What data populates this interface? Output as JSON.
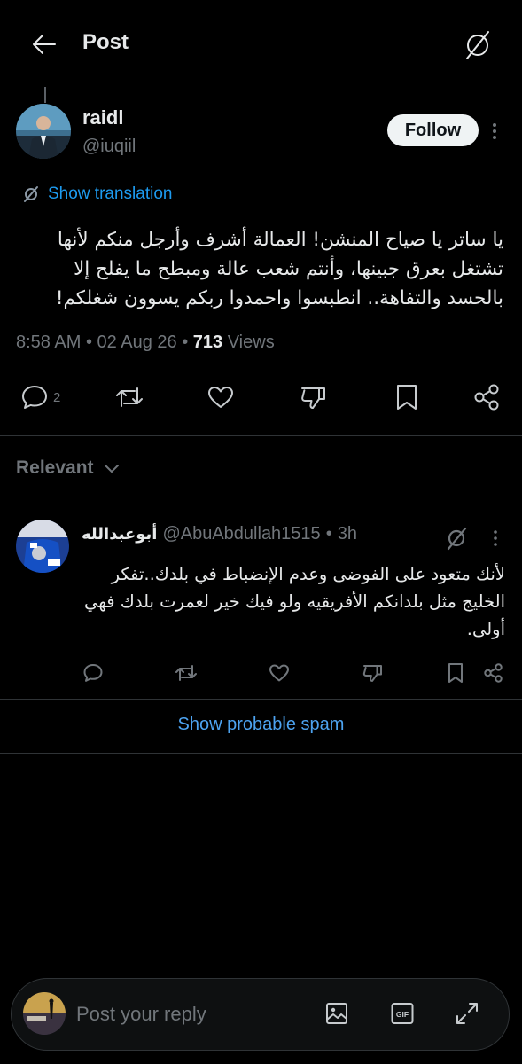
{
  "header": {
    "title": "Post",
    "back_icon": "arrow-left-icon",
    "grok_icon": "grok-icon"
  },
  "author": {
    "name": "raidl",
    "handle": "@iuqiil",
    "follow_label": "Follow"
  },
  "translation": {
    "label": "Show translation"
  },
  "post": {
    "text": "يا ساتر يا صياح المنشن! العمالة أشرف وأرجل منكم لأنها تشتغل بعرق جبينها، وأنتم شعب عالة ومبطح ما يفلح إلا بالحسد والتفاهة.. انطبسوا واحمدوا ربكم يسوون شغلكم!",
    "time": "8:58 AM",
    "sep1": "•",
    "date": "02 Aug 26",
    "sep2": "•",
    "views_count": "713",
    "views_label": "Views",
    "reply_count": "2"
  },
  "sort": {
    "label": "Relevant"
  },
  "reply": {
    "name": "أبوعبدالله",
    "handle": "@AbuAbdullah1515",
    "sep": "•",
    "time": "3h",
    "text": "لأنك متعود على الفوضى وعدم الإنضباط في بلدك..تفكر الخليج مثل بلدانكم الأفريقيه ولو فيك خير لعمرت بلدك فهي أولى."
  },
  "spam": {
    "label": "Show probable spam"
  },
  "composer": {
    "placeholder": "Post your reply",
    "gif_label": "GIF"
  },
  "colors": {
    "accent": "#1d9bf0",
    "background": "#000000",
    "muted": "#71767b"
  }
}
